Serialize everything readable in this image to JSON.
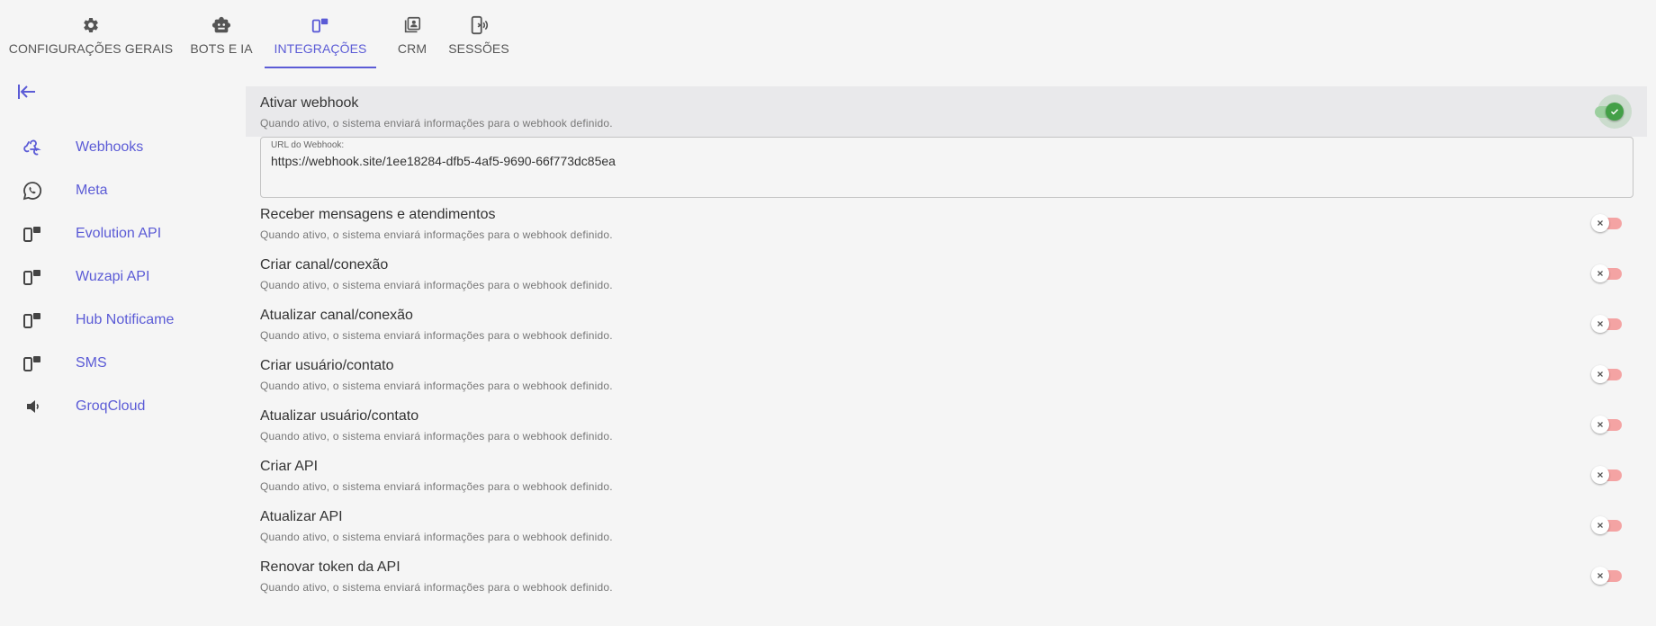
{
  "tabs": [
    {
      "label": "CONFIGURAÇÕES GERAIS",
      "icon": "gear-icon"
    },
    {
      "label": "BOTS E IA",
      "icon": "robot-icon"
    },
    {
      "label": "INTEGRAÇÕES",
      "icon": "integration-icon",
      "active": true
    },
    {
      "label": "CRM",
      "icon": "contacts-icon"
    },
    {
      "label": "SESSÕES",
      "icon": "phone-signal-icon"
    }
  ],
  "sidebar": {
    "collapse_icon": "collapse-left-icon",
    "items": [
      {
        "label": "Webhooks",
        "icon": "webhook-icon"
      },
      {
        "label": "Meta",
        "icon": "whatsapp-icon"
      },
      {
        "label": "Evolution API",
        "icon": "integration-icon"
      },
      {
        "label": "Wuzapi API",
        "icon": "integration-icon"
      },
      {
        "label": "Hub Notificame",
        "icon": "integration-icon"
      },
      {
        "label": "SMS",
        "icon": "integration-icon"
      },
      {
        "label": "GroqCloud",
        "icon": "speaker-icon"
      }
    ]
  },
  "webhook": {
    "title": "Ativar webhook",
    "description": "Quando ativo, o sistema enviará informações para o webhook definido.",
    "enabled": true,
    "url_label": "URL do Webhook:",
    "url_value": "https://webhook.site/1ee18284-dfb5-4af5-9690-66f773dc85ea"
  },
  "settings": [
    {
      "title": "Receber mensagens e atendimentos",
      "description": "Quando ativo, o sistema enviará informações para o webhook definido.",
      "enabled": false
    },
    {
      "title": "Criar canal/conexão",
      "description": "Quando ativo, o sistema enviará informações para o webhook definido.",
      "enabled": false
    },
    {
      "title": "Atualizar canal/conexão",
      "description": "Quando ativo, o sistema enviará informações para o webhook definido.",
      "enabled": false
    },
    {
      "title": "Criar usuário/contato",
      "description": "Quando ativo, o sistema enviará informações para o webhook definido.",
      "enabled": false
    },
    {
      "title": "Atualizar usuário/contato",
      "description": "Quando ativo, o sistema enviará informações para o webhook definido.",
      "enabled": false
    },
    {
      "title": "Criar API",
      "description": "Quando ativo, o sistema enviará informações para o webhook definido.",
      "enabled": false
    },
    {
      "title": "Atualizar API",
      "description": "Quando ativo, o sistema enviará informações para o webhook definido.",
      "enabled": false
    },
    {
      "title": "Renovar token da API",
      "description": "Quando ativo, o sistema enviará informações para o webhook definido.",
      "enabled": false
    }
  ],
  "colors": {
    "accent": "#5b5bd6",
    "toggle_on": "#43a047",
    "toggle_off_track": "#f4a3a3",
    "icon_gray": "#555555"
  }
}
